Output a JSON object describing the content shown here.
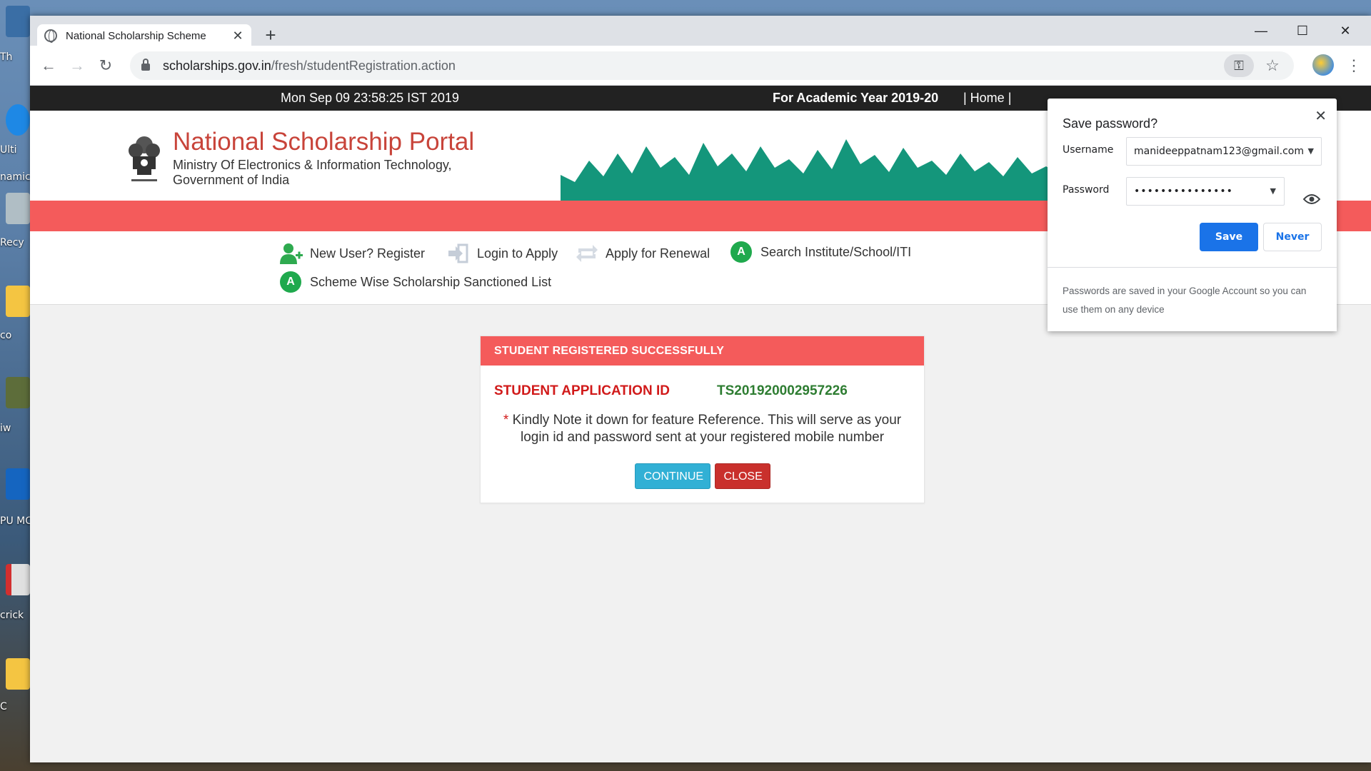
{
  "desktop": {
    "labels": [
      "Th",
      "Ulti",
      "namic",
      "Recy",
      "co",
      "iw",
      "PU MC",
      "crick",
      "C"
    ]
  },
  "browser": {
    "tab_title": "National Scholarship Scheme",
    "url_host": "scholarships.gov.in",
    "url_path": "/fresh/studentRegistration.action"
  },
  "site": {
    "datetime": "Mon Sep 09 23:58:25 IST 2019",
    "academic_year": "For Academic Year 2019-20",
    "home_link": "| Home |",
    "portal_title": "National Scholarship Portal",
    "ministry_line1": "Ministry Of Electronics & Information Technology,",
    "ministry_line2": "Government of India",
    "nav": [
      {
        "label": "New User? Register",
        "icon": "add-user-icon"
      },
      {
        "label": "Login to Apply",
        "icon": "login-arrow-icon"
      },
      {
        "label": "Apply for Renewal",
        "icon": "renew-icon"
      },
      {
        "label": "Search Institute/School/ITI",
        "icon": "green-a-icon"
      },
      {
        "label": "Scheme Wise Scholarship Sanctioned List",
        "icon": "green-a-icon"
      }
    ]
  },
  "card": {
    "header": "STUDENT REGISTERED SUCCESSFULLY",
    "app_id_label": "STUDENT APPLICATION ID",
    "app_id_value": "TS201920002957226",
    "note_asterisk": "*",
    "note_text": "Kindly Note it down for feature Reference. This will serve as your login id and password sent at your registered mobile number",
    "continue_label": "CONTINUE",
    "close_label": "CLOSE"
  },
  "password_bubble": {
    "title": "Save password?",
    "username_label": "Username",
    "username_value": "manideeppatnam123@gmail.com",
    "password_label": "Password",
    "password_mask": "•••••••••••••••",
    "save_label": "Save",
    "never_label": "Never",
    "footer": "Passwords are saved in your Google Account so you can use them on any device"
  },
  "colors": {
    "accent_red": "#f45b5b",
    "portal_title": "#c8443a",
    "app_id_green": "#2e7d32",
    "chrome_blue": "#1a73e8"
  }
}
